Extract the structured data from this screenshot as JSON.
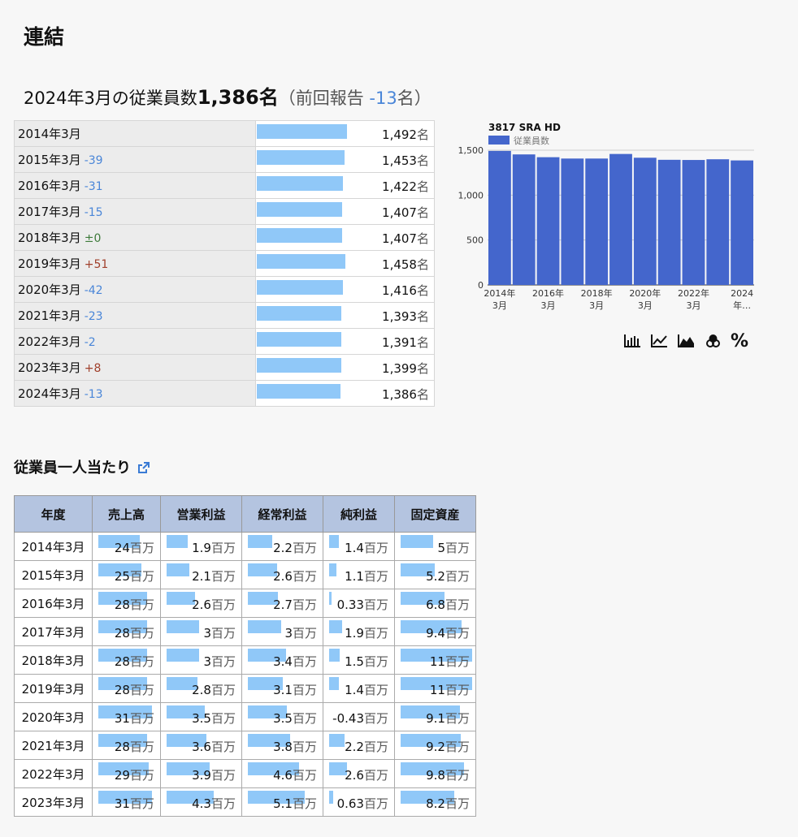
{
  "page_title": "連結",
  "summary": {
    "date": "2024年3月の従業員数",
    "count": "1,386名",
    "prev_open": "（前回報告 ",
    "prev_change": "-13",
    "prev_close": "名）"
  },
  "employees": {
    "unit": "名",
    "max": 1500,
    "rows": [
      {
        "year": "2014年3月",
        "change": "",
        "change_type": "",
        "value": "1,492",
        "num": 1492
      },
      {
        "year": "2015年3月",
        "change": "-39",
        "change_type": "neg",
        "value": "1,453",
        "num": 1453
      },
      {
        "year": "2016年3月",
        "change": "-31",
        "change_type": "neg",
        "value": "1,422",
        "num": 1422
      },
      {
        "year": "2017年3月",
        "change": "-15",
        "change_type": "neg",
        "value": "1,407",
        "num": 1407
      },
      {
        "year": "2018年3月",
        "change": "±0",
        "change_type": "zero",
        "value": "1,407",
        "num": 1407
      },
      {
        "year": "2019年3月",
        "change": "+51",
        "change_type": "pos",
        "value": "1,458",
        "num": 1458
      },
      {
        "year": "2020年3月",
        "change": "-42",
        "change_type": "neg",
        "value": "1,416",
        "num": 1416
      },
      {
        "year": "2021年3月",
        "change": "-23",
        "change_type": "neg",
        "value": "1,393",
        "num": 1393
      },
      {
        "year": "2022年3月",
        "change": "-2",
        "change_type": "neg",
        "value": "1,391",
        "num": 1391
      },
      {
        "year": "2023年3月",
        "change": "+8",
        "change_type": "pos",
        "value": "1,399",
        "num": 1399
      },
      {
        "year": "2024年3月",
        "change": "-13",
        "change_type": "neg",
        "value": "1,386",
        "num": 1386
      }
    ]
  },
  "chart_data": {
    "type": "bar",
    "title": "3817 SRA HD",
    "series": [
      {
        "name": "従業員数",
        "values": [
          1492,
          1453,
          1422,
          1407,
          1407,
          1458,
          1416,
          1393,
          1391,
          1399,
          1386
        ],
        "color": "#4466cc"
      }
    ],
    "categories": [
      "2014年3月",
      "2015年3月",
      "2016年3月",
      "2017年3月",
      "2018年3月",
      "2019年3月",
      "2020年3月",
      "2021年3月",
      "2022年3月",
      "2023年3月",
      "2024年3月"
    ],
    "tick_labels": [
      [
        "2014年",
        "3月"
      ],
      [
        "2016年",
        "3月"
      ],
      [
        "2018年",
        "3月"
      ],
      [
        "2020年",
        "3月"
      ],
      [
        "2022年",
        "3月"
      ],
      [
        "2024",
        "年…"
      ]
    ],
    "yticks": [
      "0",
      "500",
      "1,000",
      "1,500"
    ],
    "ylim": [
      0,
      1500
    ],
    "legend_position": "top-left"
  },
  "chart_tools": [
    {
      "name": "bar-chart-icon"
    },
    {
      "name": "line-chart-icon"
    },
    {
      "name": "area-chart-icon"
    },
    {
      "name": "stack-icon"
    },
    {
      "name": "percent-icon",
      "label": "%"
    }
  ],
  "per_employee": {
    "title": "従業員一人当たり",
    "headers": [
      "年度",
      "売上高",
      "営業利益",
      "経常利益",
      "純利益",
      "固定資産"
    ],
    "unit": "百万",
    "max": [
      31,
      4.3,
      5.1,
      2.6,
      11
    ],
    "rows": [
      {
        "year": "2014年3月",
        "cells": [
          {
            "v": "24",
            "n": 24
          },
          {
            "v": "1.9",
            "n": 1.9
          },
          {
            "v": "2.2",
            "n": 2.2
          },
          {
            "v": "1.4",
            "n": 1.4
          },
          {
            "v": "5",
            "n": 5
          }
        ]
      },
      {
        "year": "2015年3月",
        "cells": [
          {
            "v": "25",
            "n": 25
          },
          {
            "v": "2.1",
            "n": 2.1
          },
          {
            "v": "2.6",
            "n": 2.6
          },
          {
            "v": "1.1",
            "n": 1.1
          },
          {
            "v": "5.2",
            "n": 5.2
          }
        ]
      },
      {
        "year": "2016年3月",
        "cells": [
          {
            "v": "28",
            "n": 28
          },
          {
            "v": "2.6",
            "n": 2.6
          },
          {
            "v": "2.7",
            "n": 2.7
          },
          {
            "v": "0.33",
            "n": 0.33
          },
          {
            "v": "6.8",
            "n": 6.8
          }
        ]
      },
      {
        "year": "2017年3月",
        "cells": [
          {
            "v": "28",
            "n": 28
          },
          {
            "v": "3",
            "n": 3
          },
          {
            "v": "3",
            "n": 3
          },
          {
            "v": "1.9",
            "n": 1.9
          },
          {
            "v": "9.4",
            "n": 9.4
          }
        ]
      },
      {
        "year": "2018年3月",
        "cells": [
          {
            "v": "28",
            "n": 28
          },
          {
            "v": "3",
            "n": 3
          },
          {
            "v": "3.4",
            "n": 3.4
          },
          {
            "v": "1.5",
            "n": 1.5
          },
          {
            "v": "11",
            "n": 11
          }
        ]
      },
      {
        "year": "2019年3月",
        "cells": [
          {
            "v": "28",
            "n": 28
          },
          {
            "v": "2.8",
            "n": 2.8
          },
          {
            "v": "3.1",
            "n": 3.1
          },
          {
            "v": "1.4",
            "n": 1.4
          },
          {
            "v": "11",
            "n": 11
          }
        ]
      },
      {
        "year": "2020年3月",
        "cells": [
          {
            "v": "31",
            "n": 31
          },
          {
            "v": "3.5",
            "n": 3.5
          },
          {
            "v": "3.5",
            "n": 3.5
          },
          {
            "v": "-0.43",
            "n": 0
          },
          {
            "v": "9.1",
            "n": 9.1
          }
        ]
      },
      {
        "year": "2021年3月",
        "cells": [
          {
            "v": "28",
            "n": 28
          },
          {
            "v": "3.6",
            "n": 3.6
          },
          {
            "v": "3.8",
            "n": 3.8
          },
          {
            "v": "2.2",
            "n": 2.2
          },
          {
            "v": "9.2",
            "n": 9.2
          }
        ]
      },
      {
        "year": "2022年3月",
        "cells": [
          {
            "v": "29",
            "n": 29
          },
          {
            "v": "3.9",
            "n": 3.9
          },
          {
            "v": "4.6",
            "n": 4.6
          },
          {
            "v": "2.6",
            "n": 2.6
          },
          {
            "v": "9.8",
            "n": 9.8
          }
        ]
      },
      {
        "year": "2023年3月",
        "cells": [
          {
            "v": "31",
            "n": 31
          },
          {
            "v": "4.3",
            "n": 4.3
          },
          {
            "v": "5.1",
            "n": 5.1
          },
          {
            "v": "0.63",
            "n": 0.63
          },
          {
            "v": "8.2",
            "n": 8.2
          }
        ]
      }
    ]
  }
}
